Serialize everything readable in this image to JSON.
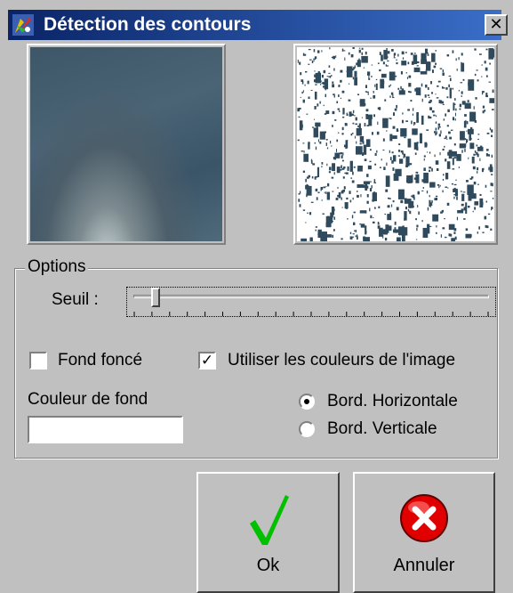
{
  "window": {
    "title": "Détection des contours",
    "close_label": "✕"
  },
  "options": {
    "group_label": "Options",
    "threshold_label": "Seuil :",
    "threshold_fraction": 0.05,
    "dark_background": {
      "label": "Fond foncé",
      "checked": false
    },
    "use_image_colors": {
      "label": "Utiliser les couleurs de l'image",
      "checked": true
    },
    "background_color": {
      "label": "Couleur de fond",
      "value": ""
    },
    "edges": [
      {
        "label": "Bord. Horizontale",
        "selected": true
      },
      {
        "label": "Bord. Verticale",
        "selected": false
      }
    ]
  },
  "buttons": {
    "ok_label": "Ok",
    "cancel_label": "Annuler"
  },
  "colors": {
    "title_bar": "#0a2466",
    "ok_check": "#00c000",
    "cancel_red": "#e00000",
    "edge_color": "#2e4a5c"
  }
}
